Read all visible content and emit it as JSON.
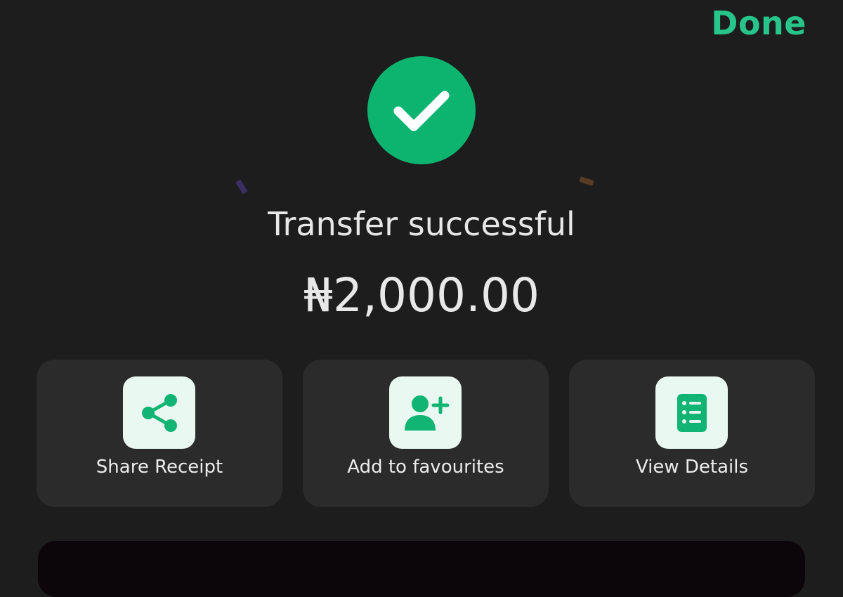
{
  "header": {
    "done_label": "Done"
  },
  "status": {
    "title": "Transfer successful",
    "amount": "₦2,000.00"
  },
  "actions": [
    {
      "label": "Share Receipt",
      "icon": "share-icon"
    },
    {
      "label": "Add to favourites",
      "icon": "add-user-icon"
    },
    {
      "label": "View Details",
      "icon": "details-list-icon"
    }
  ],
  "colors": {
    "accent": "#27c48b",
    "success": "#0db46f",
    "background": "#1d1d1d",
    "card": "#2b2b2b",
    "icon_bg": "#e9f8f1"
  }
}
